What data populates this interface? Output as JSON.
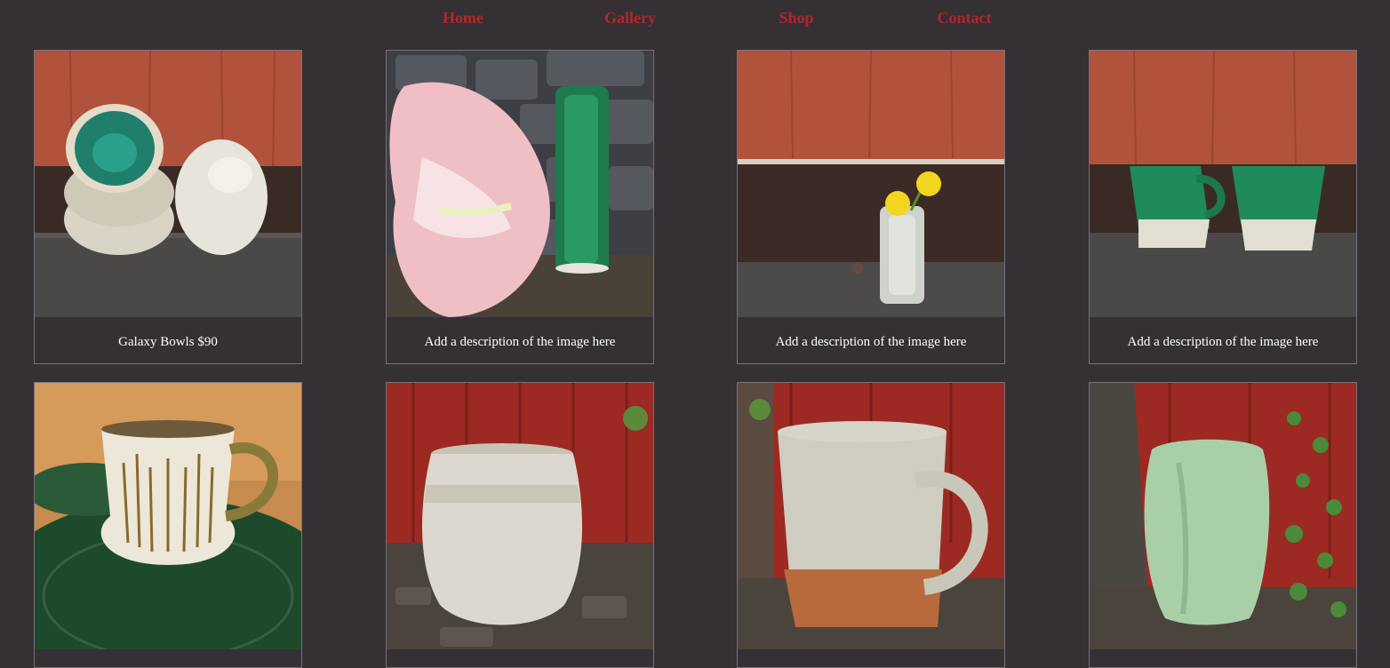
{
  "nav": {
    "items": [
      {
        "label": "Home"
      },
      {
        "label": "Gallery"
      },
      {
        "label": "Shop"
      },
      {
        "label": "Contact"
      }
    ],
    "color": "#b3262c"
  },
  "gallery": {
    "row1": [
      {
        "caption": "Galaxy Bowls $90",
        "subject": "stacked bowls against red wall"
      },
      {
        "caption": "Add a description of the image here",
        "subject": "pink flower and green vase"
      },
      {
        "caption": "Add a description of the image here",
        "subject": "small vase with yellow flowers"
      },
      {
        "caption": "Add a description of the image here",
        "subject": "two green mugs"
      }
    ],
    "row2": [
      {
        "subject": "white mug with brown brush strokes"
      },
      {
        "subject": "white jar against red wall"
      },
      {
        "subject": "white and rust mug"
      },
      {
        "subject": "pale green tumbler"
      }
    ]
  },
  "colors": {
    "background": "#353033",
    "border": "#76727a",
    "caption_text": "#ffffff"
  }
}
